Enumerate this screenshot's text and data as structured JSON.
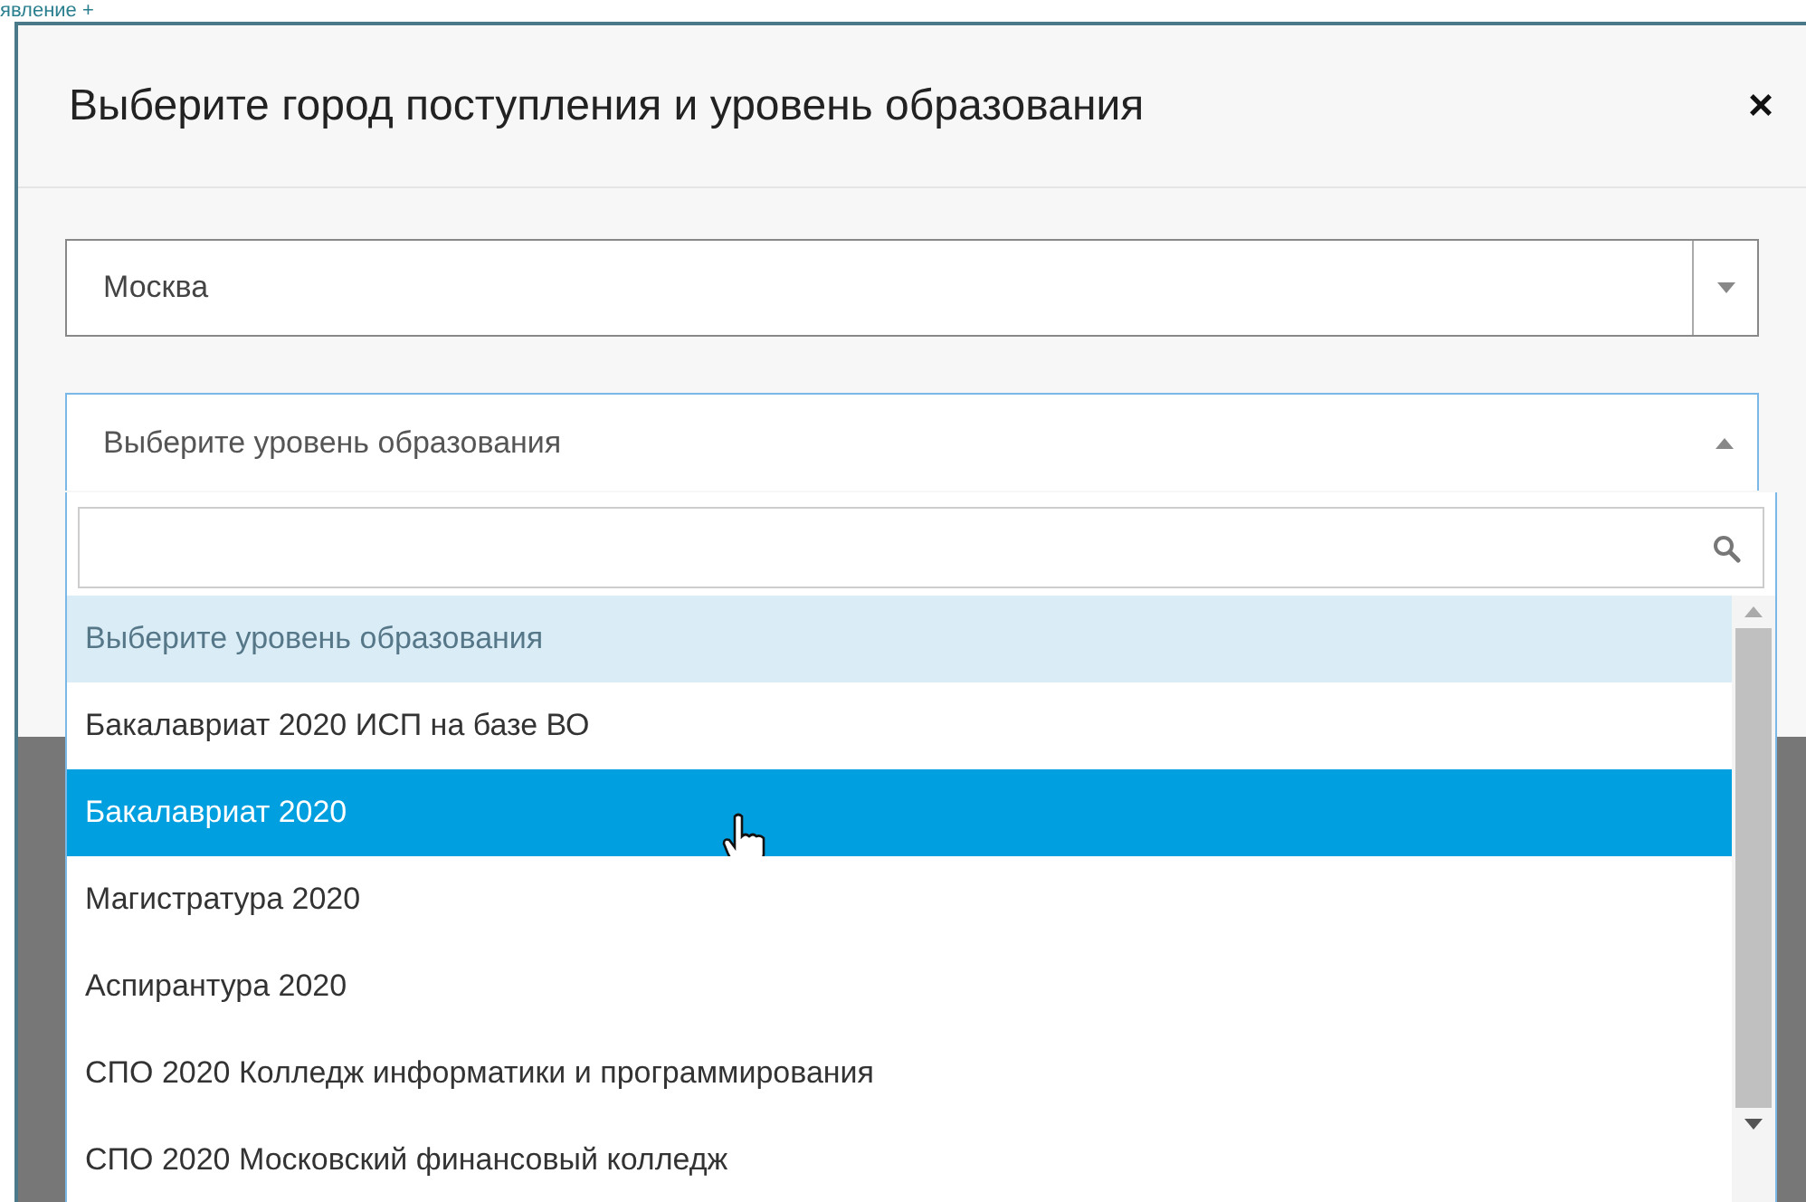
{
  "page_heading": "явление +",
  "dialog": {
    "title": "Выберите город поступления и уровень образования",
    "close": "×"
  },
  "city_select": {
    "value": "Москва",
    "expanded": false
  },
  "level_select": {
    "value": "Выберите уровень образования",
    "expanded": true
  },
  "options": [
    {
      "label": "Выберите уровень образования",
      "selected": true,
      "hovered": false
    },
    {
      "label": "Бакалавриат 2020 ИСП на базе ВО",
      "selected": false,
      "hovered": false
    },
    {
      "label": "Бакалавриат 2020",
      "selected": false,
      "hovered": true
    },
    {
      "label": "Магистратура 2020",
      "selected": false,
      "hovered": false
    },
    {
      "label": "Аспирантура 2020",
      "selected": false,
      "hovered": false
    },
    {
      "label": "СПО 2020 Колледж информатики и программирования",
      "selected": false,
      "hovered": false
    },
    {
      "label": "СПО 2020 Московский финансовый колледж",
      "selected": false,
      "hovered": false
    }
  ]
}
